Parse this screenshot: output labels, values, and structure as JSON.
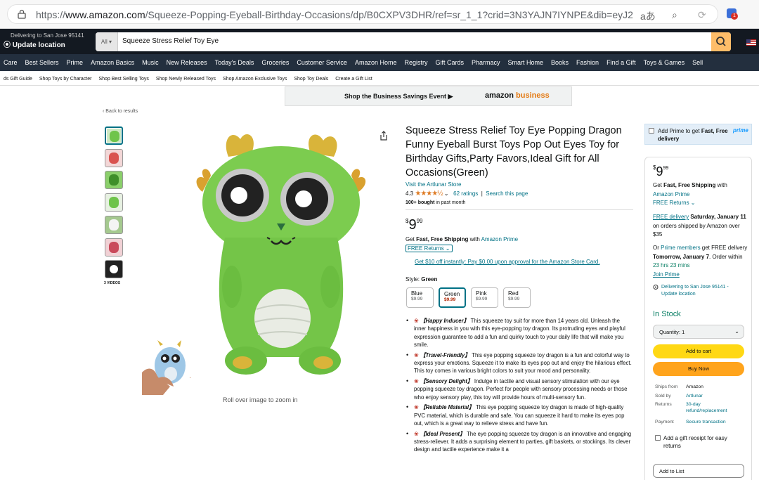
{
  "browser": {
    "url_prefix": "https://",
    "url_host": "www.amazon.com",
    "url_path": "/Squeeze-Popping-Eyeball-Birthday-Occasions/dp/B0CXPV3DHR/ref=sr_1_1?crid=3N3YAJN7IYNPE&dib=eyJ2IjoiMSJ...",
    "read_aloud": "aあ",
    "notification_count": "1"
  },
  "header": {
    "deliver_line1": "Delivering to San Jose 95141",
    "deliver_line2": "Update location",
    "search_category": "All",
    "search_query": "Squeeze Stress Relief Toy Eye"
  },
  "nav": {
    "items": [
      "Care",
      "Best Sellers",
      "Prime",
      "Amazon Basics",
      "Music",
      "New Releases",
      "Today's Deals",
      "Groceries",
      "Customer Service",
      "Amazon Home",
      "Registry",
      "Gift Cards",
      "Pharmacy",
      "Smart Home",
      "Books",
      "Fashion",
      "Find a Gift",
      "Toys & Games",
      "Sell"
    ]
  },
  "subnav": {
    "items": [
      "ds Gift Guide",
      "Shop Toys by Character",
      "Shop Best Selling Toys",
      "Shop Newly Released Toys",
      "Shop Amazon Exclusive Toys",
      "Shop Toy Deals",
      "Create a Gift List"
    ]
  },
  "banner": {
    "text": "Shop the Business Savings Event ▶",
    "logo_a": "amazon ",
    "logo_b": "business"
  },
  "back_link": "‹ Back to results",
  "gallery": {
    "videos_label": "3 VIDEOS",
    "zoom_hint": "Roll over image to zoom in"
  },
  "product": {
    "title": "Squeeze Stress Relief Toy Eye Popping Dragon Funny Eyeball Burst Toys Pop Out Eyes Toy for Birthday Gifts,Party Favors,Ideal Gift for All Occasions(Green)",
    "store": "Visit the Artlunar Store",
    "rating": "4.3",
    "stars": "★★★★½",
    "ratings_count": "62 ratings",
    "search_page": "Search this page",
    "bought_bold": "100+ bought",
    "bought_rest": " in past month",
    "price_sym": "$",
    "price_whole": "9",
    "price_frac": "99",
    "ship_a": "Get ",
    "ship_b": "Fast, Free Shipping",
    "ship_c": " with ",
    "ship_d": "Amazon Prime",
    "free_returns": "FREE Returns ⌄",
    "promo": "Get $10 off instantly: Pay $0.00 upon approval for the Amazon Store Card.",
    "style_label": "Style: ",
    "style_value": "Green",
    "styles": [
      {
        "name": "Blue",
        "price": "$9.99"
      },
      {
        "name": "Green",
        "price": "$9.99"
      },
      {
        "name": "Pink",
        "price": "$9.99"
      },
      {
        "name": "Red",
        "price": "$9.99"
      }
    ],
    "bullets": [
      {
        "tag": "【Happy Inducer】",
        "text": " This squeeze toy suit for more than 14 years old. Unleash the inner happiness in you with this eye-popping toy dragon. Its protruding eyes and playful expression guarantee to add a fun and quirky touch to your daily life that will make you smile."
      },
      {
        "tag": "【Travel-Friendly】",
        "text": " This eye popping squeeze toy dragon is a fun and colorful way to express your emotions. Squeeze it to make its eyes pop out and enjoy the hilarious effect. This toy comes in various bright colors to suit your mood and personality."
      },
      {
        "tag": "【Sensory Delight】",
        "text": " Indulge in tactile and visual sensory stimulation with our eye popping squeeze toy dragon. Perfect for people with sensory processing needs or those who enjoy sensory play, this toy will provide hours of multi-sensory fun."
      },
      {
        "tag": "【Reliable Material】",
        "text": " This eye popping squeeze toy dragon is made of high-quality PVC material, which is durable and safe. You can squeeze it hard to make its eyes pop out, which is a great way to relieve stress and have fun."
      },
      {
        "tag": "【Ideal Present】",
        "text": " The eye popping squeeze toy dragon is an innovative and engaging stress-reliever. It adds a surprising element to parties, gift baskets, or stockings. Its clever design and tactile experience make it a"
      }
    ]
  },
  "prime_box": {
    "text_a": "Add Prime to get ",
    "text_b": "Fast, Free delivery",
    "logo": "prime"
  },
  "buybox": {
    "price_sym": "$",
    "price_whole": "9",
    "price_frac": "99",
    "ship_a": "Get ",
    "ship_b": "Fast, Free Shipping",
    "ship_c": " with",
    "ship_d": "Amazon Prime",
    "free_returns": "FREE Returns ⌄",
    "free_delivery_link": "FREE delivery",
    "free_delivery_date": " Saturday, January 11",
    "free_delivery_rest": " on orders shipped by Amazon over $35",
    "or": "Or ",
    "prime_members": "Prime members",
    "fastest_a": " get FREE delivery ",
    "fastest_date": "Tomorrow, January 7",
    "order_within": ". Order within ",
    "countdown": "23 hrs 23 mins",
    "join_prime": "Join Prime",
    "location": "Delivering to San Jose 95141 - Update location",
    "in_stock": "In Stock",
    "quantity": "Quantity: 1",
    "add_to_cart": "Add to cart",
    "buy_now": "Buy Now",
    "ships_from_k": "Ships from",
    "ships_from_v": "Amazon",
    "sold_by_k": "Sold by",
    "sold_by_v": "Artlunar",
    "returns_k": "Returns",
    "returns_v": "30-day refund/replacement",
    "payment_k": "Payment",
    "payment_v": "Secure transaction",
    "gift_receipt": "Add a gift receipt for easy returns",
    "add_to_list": "Add to List"
  },
  "colors": {
    "link": "#007185",
    "price_red": "#b12704",
    "cart_yellow": "#ffd814",
    "buy_orange": "#ffa41c",
    "stock_green": "#067d62",
    "header_dark": "#131921"
  }
}
